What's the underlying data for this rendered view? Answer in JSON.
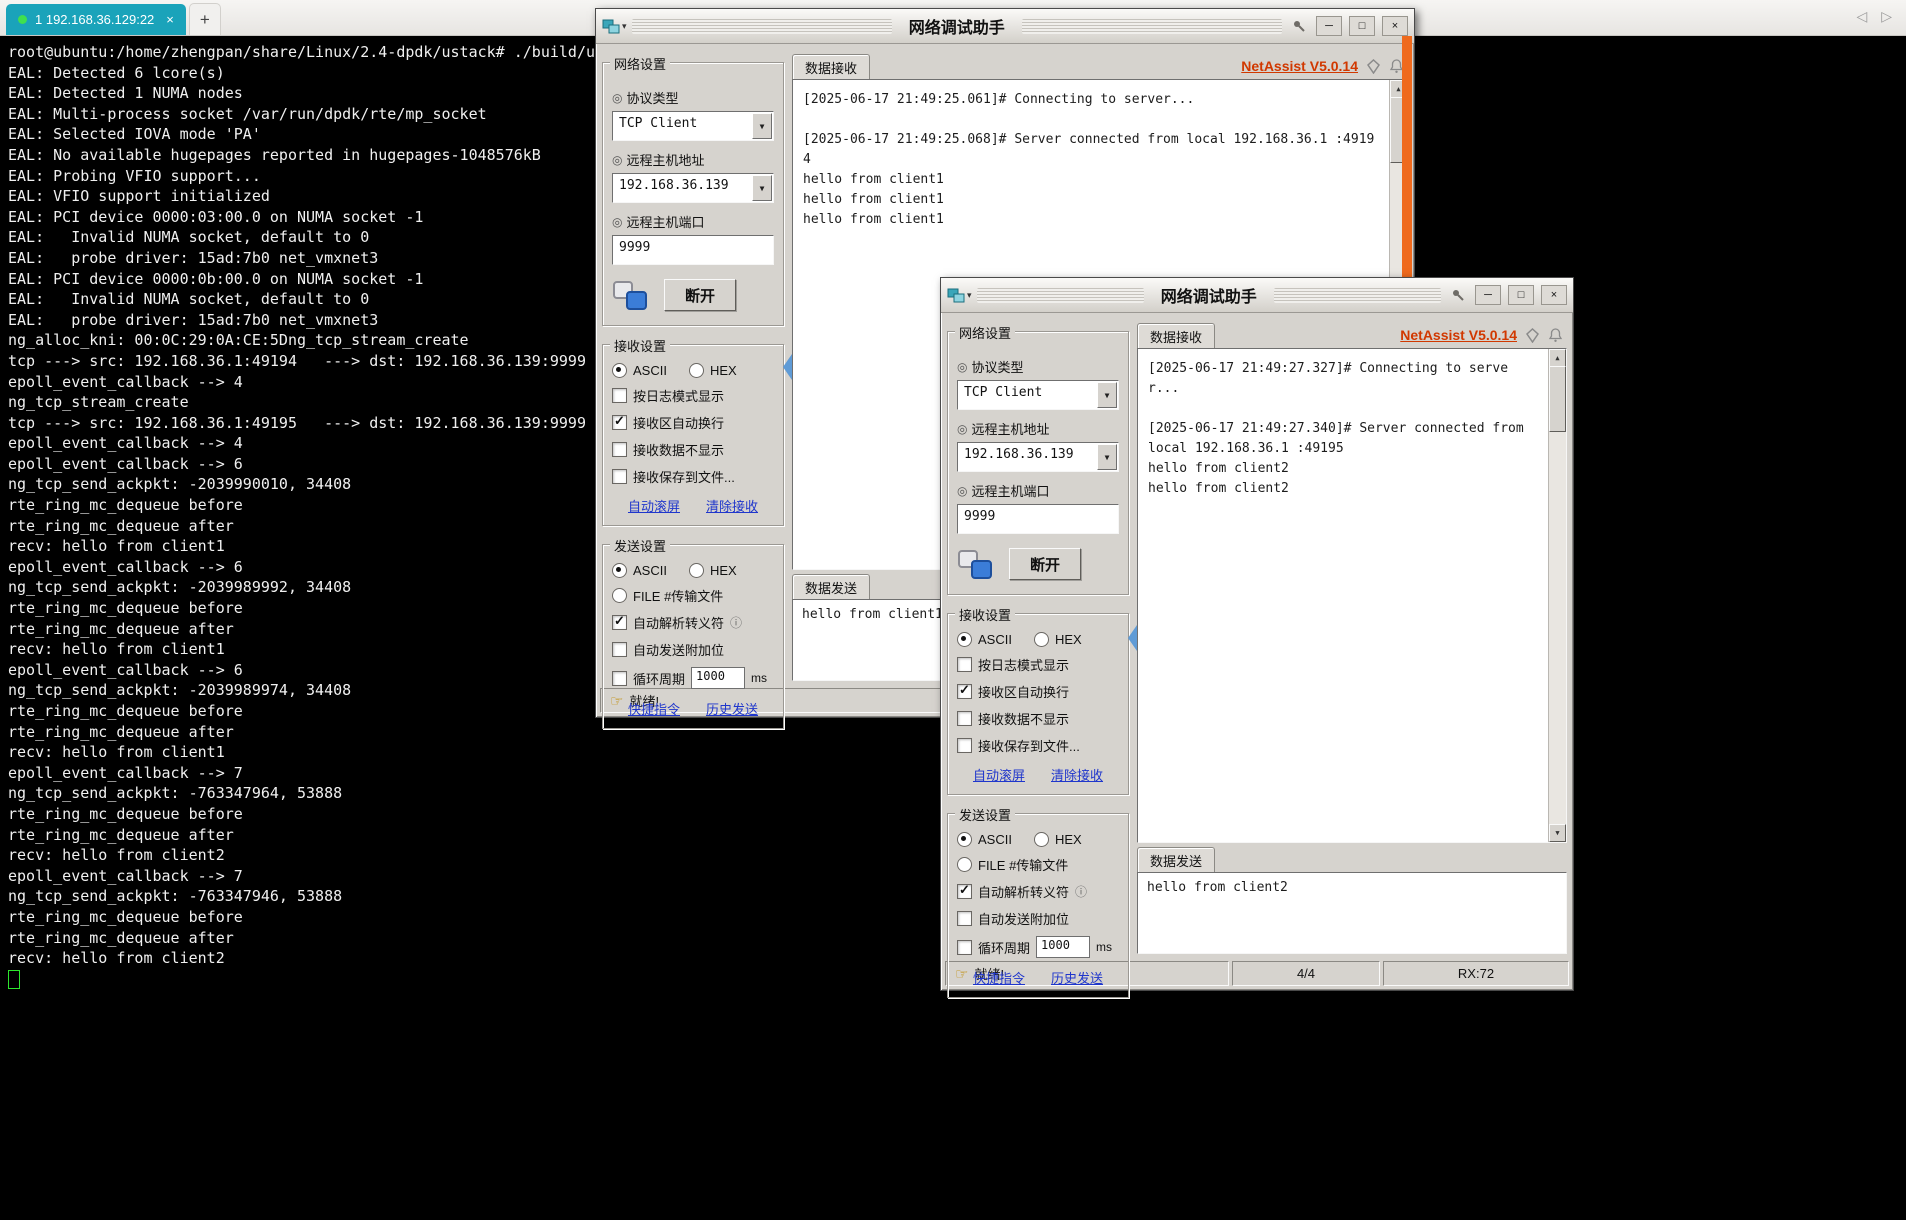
{
  "tabbar": {
    "tab_label": "1 192.168.36.129:22",
    "close": "×",
    "new_tab": "+",
    "nav_left": "◁",
    "nav_right": "▷"
  },
  "terminal": {
    "lines": [
      "root@ubuntu:/home/zhengpan/share/Linux/2.4-dpdk/ustack# ./build/u",
      "EAL: Detected 6 lcore(s)",
      "EAL: Detected 1 NUMA nodes",
      "EAL: Multi-process socket /var/run/dpdk/rte/mp_socket",
      "EAL: Selected IOVA mode 'PA'",
      "EAL: No available hugepages reported in hugepages-1048576kB",
      "EAL: Probing VFIO support...",
      "EAL: VFIO support initialized",
      "EAL: PCI device 0000:03:00.0 on NUMA socket -1",
      "EAL:   Invalid NUMA socket, default to 0",
      "EAL:   probe driver: 15ad:7b0 net_vmxnet3",
      "EAL: PCI device 0000:0b:00.0 on NUMA socket -1",
      "EAL:   Invalid NUMA socket, default to 0",
      "EAL:   probe driver: 15ad:7b0 net_vmxnet3",
      "ng_alloc_kni: 00:0C:29:0A:CE:5Dng_tcp_stream_create",
      "tcp ---> src: 192.168.36.1:49194   ---> dst: 192.168.36.139:9999",
      "epoll_event_callback --> 4",
      "ng_tcp_stream_create",
      "tcp ---> src: 192.168.36.1:49195   ---> dst: 192.168.36.139:9999",
      "epoll_event_callback --> 4",
      "epoll_event_callback --> 6",
      "ng_tcp_send_ackpkt: -2039990010, 34408",
      "rte_ring_mc_dequeue before",
      "rte_ring_mc_dequeue after",
      "recv: hello from client1",
      "epoll_event_callback --> 6",
      "ng_tcp_send_ackpkt: -2039989992, 34408",
      "rte_ring_mc_dequeue before",
      "rte_ring_mc_dequeue after",
      "recv: hello from client1",
      "epoll_event_callback --> 6",
      "ng_tcp_send_ackpkt: -2039989974, 34408",
      "rte_ring_mc_dequeue before",
      "rte_ring_mc_dequeue after",
      "recv: hello from client1",
      "epoll_event_callback --> 7",
      "ng_tcp_send_ackpkt: -763347964, 53888",
      "rte_ring_mc_dequeue before",
      "rte_ring_mc_dequeue after",
      "recv: hello from client2",
      "epoll_event_callback --> 7",
      "ng_tcp_send_ackpkt: -763347946, 53888",
      "rte_ring_mc_dequeue before",
      "rte_ring_mc_dequeue after",
      "recv: hello from client2"
    ]
  },
  "netassist1": {
    "title": "网络调试助手",
    "version": "NetAssist V5.0.14",
    "net": {
      "title": "网络设置",
      "protocol_label": "协议类型",
      "protocol_value": "TCP Client",
      "host_label": "远程主机地址",
      "host_value": "192.168.36.139",
      "port_label": "远程主机端口",
      "port_value": "9999",
      "disconnect": "断开"
    },
    "recv": {
      "title": "接收设置",
      "ascii": "ASCII",
      "hex": "HEX",
      "options": [
        {
          "kind": "check",
          "label": "按日志模式显示",
          "checked": false
        },
        {
          "kind": "check",
          "label": "接收区自动换行",
          "checked": true
        },
        {
          "kind": "check",
          "label": "接收数据不显示",
          "checked": false
        },
        {
          "kind": "check",
          "label": "接收保存到文件...",
          "checked": false
        }
      ],
      "link1": "自动滚屏",
      "link2": "清除接收"
    },
    "send": {
      "title": "发送设置",
      "ascii": "ASCII",
      "hex": "HEX",
      "options": [
        {
          "kind": "radio",
          "label": "FILE #传输文件",
          "checked": false
        },
        {
          "kind": "check",
          "label": "自动解析转义符",
          "checked": true,
          "info": true
        },
        {
          "kind": "check",
          "label": "自动发送附加位",
          "checked": false
        },
        {
          "kind": "check",
          "label": "循环周期",
          "checked": false,
          "value": "1000",
          "unit": "ms"
        }
      ],
      "link1": "快捷指令",
      "link2": "历史发送"
    },
    "recv_tab": "数据接收",
    "send_tab": "数据发送",
    "recv_log": [
      "[2025-06-17 21:49:25.061]# Connecting to server...",
      "",
      "[2025-06-17 21:49:25.068]# Server connected from local 192.168.36.1 :49194",
      "hello from client1",
      "hello from client1",
      "hello from client1"
    ],
    "send_text": "hello from client1",
    "status": {
      "ready": "就绪!",
      "count": "",
      "rx": ""
    }
  },
  "netassist2": {
    "title": "网络调试助手",
    "version": "NetAssist V5.0.14",
    "net": {
      "title": "网络设置",
      "protocol_label": "协议类型",
      "protocol_value": "TCP Client",
      "host_label": "远程主机地址",
      "host_value": "192.168.36.139",
      "port_label": "远程主机端口",
      "port_value": "9999",
      "disconnect": "断开"
    },
    "recv": {
      "title": "接收设置",
      "ascii": "ASCII",
      "hex": "HEX",
      "options": [
        {
          "kind": "check",
          "label": "按日志模式显示",
          "checked": false
        },
        {
          "kind": "check",
          "label": "接收区自动换行",
          "checked": true
        },
        {
          "kind": "check",
          "label": "接收数据不显示",
          "checked": false
        },
        {
          "kind": "check",
          "label": "接收保存到文件...",
          "checked": false
        }
      ],
      "link1": "自动滚屏",
      "link2": "清除接收"
    },
    "send": {
      "title": "发送设置",
      "ascii": "ASCII",
      "hex": "HEX",
      "options": [
        {
          "kind": "radio",
          "label": "FILE #传输文件",
          "checked": false
        },
        {
          "kind": "check",
          "label": "自动解析转义符",
          "checked": true,
          "info": true
        },
        {
          "kind": "check",
          "label": "自动发送附加位",
          "checked": false
        },
        {
          "kind": "check",
          "label": "循环周期",
          "checked": false,
          "value": "1000",
          "unit": "ms"
        }
      ],
      "link1": "快捷指令",
      "link2": "历史发送"
    },
    "recv_tab": "数据接收",
    "send_tab": "数据发送",
    "recv_log": [
      "[2025-06-17 21:49:27.327]# Connecting to server...",
      "",
      "[2025-06-17 21:49:27.340]# Server connected from local 192.168.36.1 :49195",
      "hello from client2",
      "hello from client2"
    ],
    "send_text": "hello from client2",
    "status": {
      "ready": "就绪!",
      "count": "4/4",
      "rx": "RX:72"
    }
  }
}
